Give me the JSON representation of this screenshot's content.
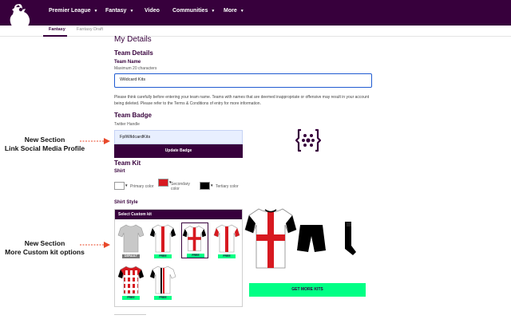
{
  "nav": {
    "items": [
      {
        "label": "Premier League",
        "has_menu": true
      },
      {
        "label": "Fantasy",
        "has_menu": true
      },
      {
        "label": "Video",
        "has_menu": false
      },
      {
        "label": "Communities",
        "has_menu": true
      },
      {
        "label": "More",
        "has_menu": true
      }
    ],
    "chevron": "▼"
  },
  "subnav": {
    "tabs": [
      {
        "label": "Fantasy",
        "active": true
      },
      {
        "label": "Fantasy Draft",
        "active": false
      }
    ]
  },
  "page": {
    "title": "My Details",
    "team_details": {
      "heading": "Team Details",
      "team_name_label": "Team Name",
      "team_name_hint": "Maximum 20 characters",
      "team_name_value": "Wildcard Kits",
      "warning": "Please think carefully before entering your team name. Teams with names that are deemed inappropriate or offensive may result in your account being deleted. Please refer to the Terms & Conditions of entry for more information."
    },
    "team_badge": {
      "heading": "Team Badge",
      "twitter_label": "Twitter Handle",
      "twitter_value": "FplWildcardKits",
      "update_button": "Update Badge"
    },
    "team_kit": {
      "heading": "Team Kit",
      "shirt_label": "Shirt",
      "primary_label": "Primary color",
      "secondary_label": "Secondary color",
      "tertiary_label": "Tertiary color",
      "primary_color": "#ffffff",
      "secondary_color": "#d71920",
      "tertiary_color": "#000000",
      "swatch_arrow": "▼",
      "shirt_style_label": "Shirt Style",
      "select_custom": "Select Custom kit",
      "default_tag": "DEFAULT",
      "free_tag": "FREE",
      "more_kits_button": "GET MORE KITS"
    }
  },
  "annotations": [
    {
      "line1": "New Section",
      "line2": "Link Social Media Profile"
    },
    {
      "line1": "New Section",
      "line2": "More Custom kit options"
    }
  ],
  "colors": {
    "brand_purple": "#37003c",
    "accent_green": "#00ff85",
    "annotation_arrow": "#e8482a",
    "kit_red": "#d71920"
  }
}
